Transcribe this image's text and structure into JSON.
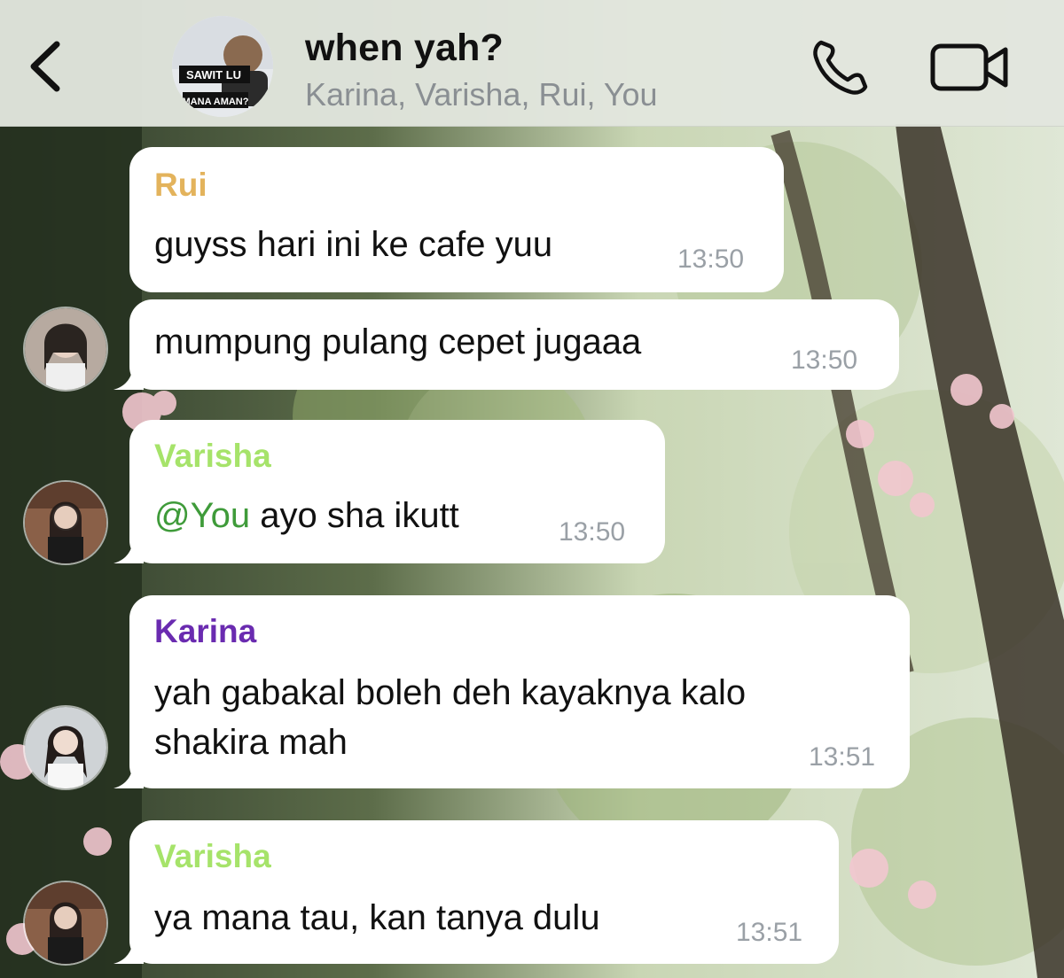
{
  "header": {
    "title": "when yah?",
    "members": "Karina, Varisha, Rui, You",
    "avatar_caption_top": "SAWIT LU",
    "avatar_caption_bottom": "MANA AMAN?",
    "back_icon": "chevron-left-icon",
    "call_icon": "phone-icon",
    "video_icon": "video-camera-icon"
  },
  "colors": {
    "rui": "#e3b35c",
    "varisha": "#a6e36a",
    "karina": "#6a2bb0",
    "timestamp": "#9aa0a6",
    "mention": "#3f9b3a"
  },
  "messages": [
    {
      "sender": "Rui",
      "text": "guyss hari ini ke cafe yuu",
      "time": "13:50"
    },
    {
      "sender": "",
      "text": "mumpung pulang cepet jugaaa",
      "time": "13:50"
    },
    {
      "sender": "Varisha",
      "mention": "@You",
      "text": " ayo sha ikutt",
      "time": "13:50"
    },
    {
      "sender": "Karina",
      "text_line1": "yah gabakal boleh deh kayaknya kalo",
      "text_line2": "shakira mah",
      "time": "13:51"
    },
    {
      "sender": "Varisha",
      "text": "ya mana tau, kan tanya dulu",
      "time": "13:51"
    }
  ]
}
